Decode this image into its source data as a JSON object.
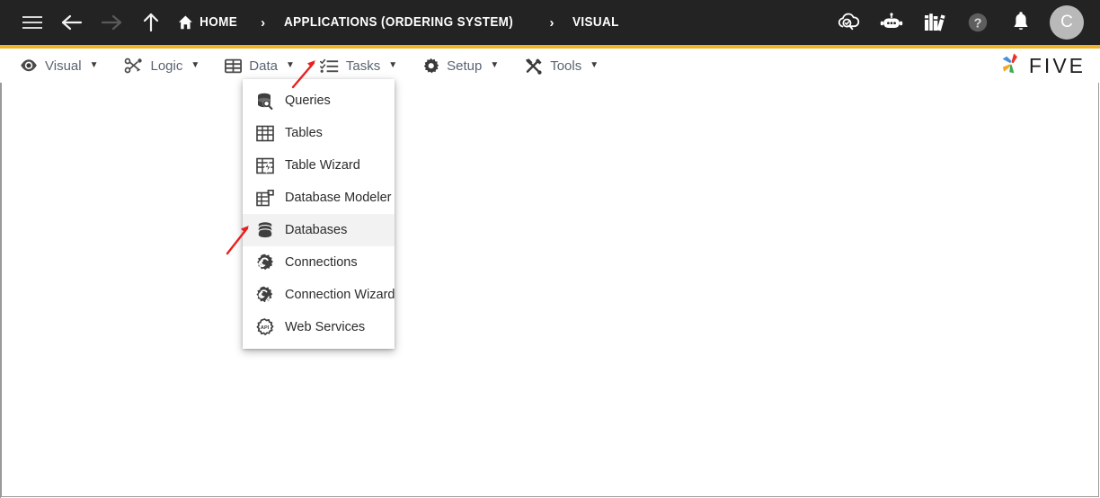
{
  "window": {
    "title": "Five - Visual",
    "accent_color": "#f0b429",
    "header_bg": "#232323",
    "annotation_color": "#e8201e"
  },
  "topbar": {
    "nav": {
      "menu_icon": "hamburger-icon",
      "back_icon": "arrow-left-icon",
      "forward_icon": "arrow-right-icon",
      "forward_disabled": true,
      "up_icon": "arrow-up-icon"
    },
    "breadcrumb": {
      "separator": "›",
      "items": [
        {
          "label": "HOME",
          "icon": "home-icon"
        },
        {
          "label": "APPLICATIONS (ORDERING SYSTEM)",
          "icon": ""
        },
        {
          "label": "VISUAL",
          "icon": ""
        }
      ]
    },
    "actions": [
      {
        "name": "cloud-search-icon",
        "title": "Cloud"
      },
      {
        "name": "robot-assistant-icon",
        "title": "Assistant"
      },
      {
        "name": "library-books-icon",
        "title": "Documentation"
      },
      {
        "name": "help-icon",
        "title": "Help"
      },
      {
        "name": "notifications-bell-icon",
        "title": "Notifications"
      }
    ],
    "avatar": {
      "initial": "C",
      "bg": "#b9b9b9"
    }
  },
  "menubar": {
    "items": [
      {
        "label": "Visual",
        "icon": "eye-icon",
        "caret": "▼",
        "open": false
      },
      {
        "label": "Logic",
        "icon": "nodes-graph-icon",
        "caret": "▼",
        "open": false
      },
      {
        "label": "Data",
        "icon": "grid-table-icon",
        "caret": "▼",
        "open": true
      },
      {
        "label": "Tasks",
        "icon": "checklist-icon",
        "caret": "▼",
        "open": false
      },
      {
        "label": "Setup",
        "icon": "gear-icon",
        "caret": "▼",
        "open": false
      },
      {
        "label": "Tools",
        "icon": "tools-icon",
        "caret": "▼",
        "open": false
      }
    ],
    "brand": {
      "text": "FIVE",
      "logo": "five-pinwheel-logo"
    }
  },
  "data_menu": {
    "open": true,
    "items": [
      {
        "label": "Queries",
        "icon": "database-search-icon",
        "highlighted": false
      },
      {
        "label": "Tables",
        "icon": "table-grid-icon",
        "highlighted": false
      },
      {
        "label": "Table Wizard",
        "icon": "table-wizard-icon",
        "highlighted": false
      },
      {
        "label": "Database Modeler",
        "icon": "database-modeler-icon",
        "highlighted": false
      },
      {
        "label": "Databases",
        "icon": "database-stack-icon",
        "highlighted": true
      },
      {
        "label": "Connections",
        "icon": "connection-gear-icon",
        "highlighted": false
      },
      {
        "label": "Connection Wizard",
        "icon": "connection-wizard-icon",
        "highlighted": false
      },
      {
        "label": "Web Services",
        "icon": "web-services-api-icon",
        "highlighted": false
      }
    ]
  },
  "annotations": [
    {
      "name": "arrow-to-databases",
      "target": "Databases"
    },
    {
      "name": "arrow-to-data-caret",
      "target": "Data dropdown caret"
    }
  ]
}
